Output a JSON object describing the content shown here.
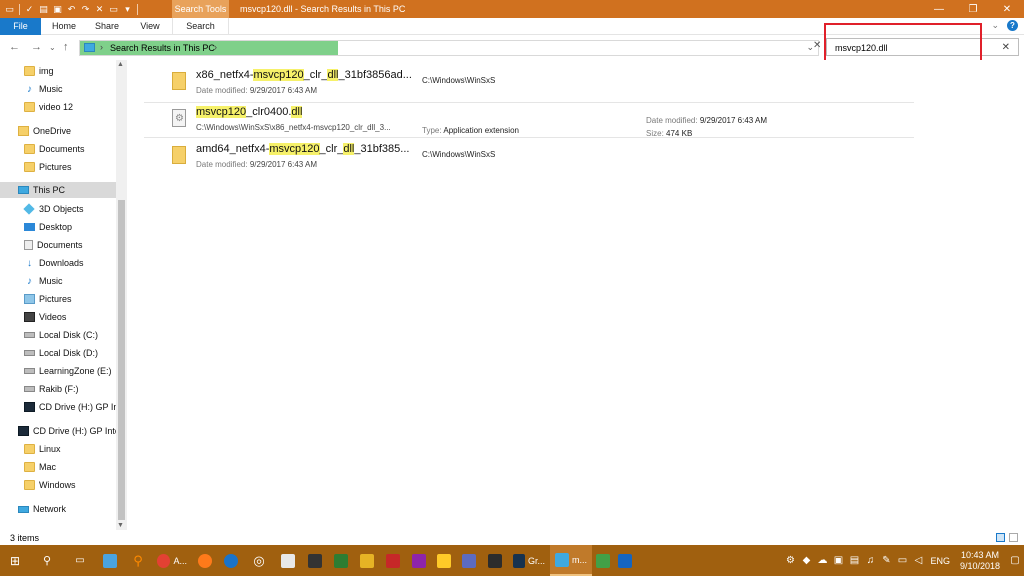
{
  "titlebar": {
    "context_tab": "Search Tools",
    "title": "msvcp120.dll - Search Results in This PC",
    "controls": [
      "minimize-icon",
      "restore-icon",
      "close-icon"
    ]
  },
  "ribbon": {
    "tabs": [
      {
        "label": "File"
      },
      {
        "label": "Home"
      },
      {
        "label": "Share"
      },
      {
        "label": "View"
      },
      {
        "label": "Search"
      }
    ],
    "accent": "#1979ca",
    "titlebar_color": "#d0711f"
  },
  "address": {
    "location": "Search Results in This PC",
    "progress_percent": 35,
    "progress_color": "#7fd08a"
  },
  "search": {
    "value": "msvcp120.dll"
  },
  "sidebar": {
    "items": [
      {
        "label": "img",
        "icon": "folder-icon"
      },
      {
        "label": "Music",
        "icon": "music-icon"
      },
      {
        "label": "video 12",
        "icon": "folder-icon"
      },
      {
        "label": "OneDrive",
        "icon": "onedrive-icon"
      },
      {
        "label": "Documents",
        "icon": "folder-icon"
      },
      {
        "label": "Pictures",
        "icon": "folder-icon"
      },
      {
        "label": "This PC",
        "icon": "pc-icon",
        "selected": true
      },
      {
        "label": "3D Objects",
        "icon": "3d-objects-icon"
      },
      {
        "label": "Desktop",
        "icon": "desktop-icon"
      },
      {
        "label": "Documents",
        "icon": "documents-icon"
      },
      {
        "label": "Downloads",
        "icon": "downloads-icon"
      },
      {
        "label": "Music",
        "icon": "music-icon"
      },
      {
        "label": "Pictures",
        "icon": "pictures-icon"
      },
      {
        "label": "Videos",
        "icon": "videos-icon"
      },
      {
        "label": "Local Disk (C:)",
        "icon": "disk-icon"
      },
      {
        "label": "Local Disk (D:)",
        "icon": "disk-icon"
      },
      {
        "label": "LearningZone (E:)",
        "icon": "disk-icon"
      },
      {
        "label": "Rakib (F:)",
        "icon": "disk-icon"
      },
      {
        "label": "CD Drive (H:) GP Int",
        "icon": "cd-drive-icon"
      },
      {
        "label": "CD Drive (H:) GP Inte",
        "icon": "cd-drive-icon"
      },
      {
        "label": "Linux",
        "icon": "folder-icon"
      },
      {
        "label": "Mac",
        "icon": "folder-icon"
      },
      {
        "label": "Windows",
        "icon": "folder-icon"
      },
      {
        "label": "Network",
        "icon": "network-icon"
      }
    ]
  },
  "results": [
    {
      "name_pre": "x86_netfx4-",
      "name_hit1": "msvcp120",
      "name_mid": "_clr_",
      "name_hit2": "dll",
      "name_post": "_31bf3856ad...",
      "modified_label": "Date modified:",
      "modified": "9/29/2017 6:43 AM",
      "path": "C:\\Windows\\WinSxS",
      "kind": "folder"
    },
    {
      "name_pre": "",
      "name_hit1": "msvcp120",
      "name_mid": "_clr0400.",
      "name_hit2": "dll",
      "name_post": "",
      "subpath": "C:\\Windows\\WinSxS\\x86_netfx4-msvcp120_clr_dll_3...",
      "type_label": "Type:",
      "type": "Application extension",
      "modified_label": "Date modified:",
      "modified": "9/29/2017 6:43 AM",
      "size_label": "Size:",
      "size": "474 KB",
      "kind": "file"
    },
    {
      "name_pre": "amd64_netfx4-",
      "name_hit1": "msvcp120",
      "name_mid": "_clr_",
      "name_hit2": "dll",
      "name_post": "_31bf385...",
      "modified_label": "Date modified:",
      "modified": "9/29/2017 6:43 AM",
      "path": "C:\\Windows\\WinSxS",
      "kind": "folder"
    }
  ],
  "status": {
    "count": "3 items"
  },
  "taskbar": {
    "apps": [
      {
        "label": "A...",
        "icon": "chrome-icon"
      },
      {
        "label": "Gr...",
        "icon": "app-icon"
      },
      {
        "label": "m...",
        "icon": "file-explorer-icon"
      }
    ],
    "language": "ENG",
    "time": "10:43 AM",
    "date": "9/10/2018"
  }
}
